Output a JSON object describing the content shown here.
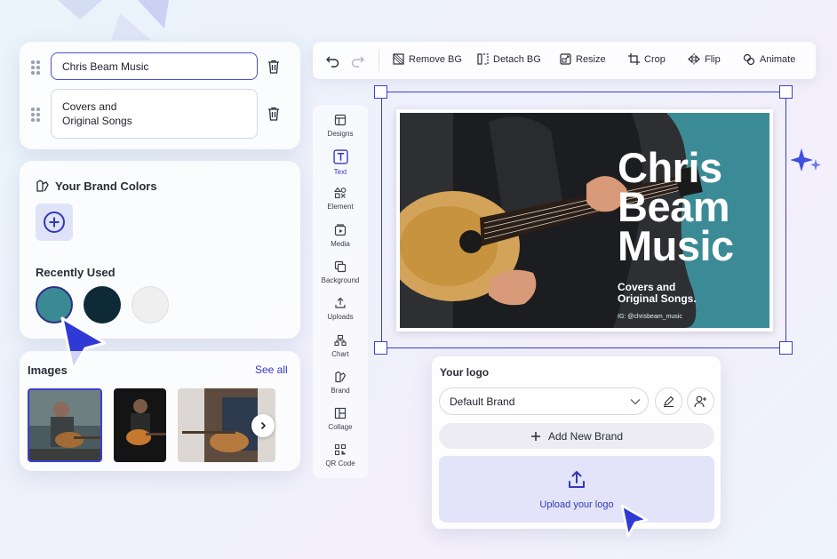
{
  "text_fields": [
    {
      "value": "Chris Beam Music"
    },
    {
      "value_line1": "Covers and",
      "value_line2": "Original Songs"
    }
  ],
  "brand_colors": {
    "title": "Your Brand Colors",
    "recently_used_label": "Recently Used",
    "swatches": [
      "#3a8a94",
      "#0d2a36",
      "#efefef"
    ]
  },
  "images": {
    "title": "Images",
    "see_all": "See all"
  },
  "side_tools": [
    {
      "label": "Designs",
      "icon": "layout-icon"
    },
    {
      "label": "Text",
      "icon": "text-icon"
    },
    {
      "label": "Element",
      "icon": "shapes-icon"
    },
    {
      "label": "Media",
      "icon": "media-icon"
    },
    {
      "label": "Background",
      "icon": "background-icon"
    },
    {
      "label": "Uploads",
      "icon": "upload-icon"
    },
    {
      "label": "Chart",
      "icon": "chart-icon"
    },
    {
      "label": "Brand",
      "icon": "brand-icon"
    },
    {
      "label": "Collage",
      "icon": "collage-icon"
    },
    {
      "label": "QR Code",
      "icon": "qr-code-icon"
    }
  ],
  "toolbar": {
    "remove_bg": "Remove BG",
    "detach_bg": "Detach BG",
    "resize": "Resize",
    "crop": "Crop",
    "flip": "Flip",
    "animate": "Animate"
  },
  "design": {
    "title": "Chris\nBeam\nMusic",
    "subtitle": "Covers and\nOriginal Songs.",
    "handle": "IG: @chrisbeam_music"
  },
  "logo_panel": {
    "title": "Your logo",
    "brand_select": "Default Brand",
    "add_brand": "Add New Brand",
    "upload": "Upload your logo"
  },
  "colors": {
    "accent": "#3a3fcf",
    "teal": "#3b8b96"
  }
}
